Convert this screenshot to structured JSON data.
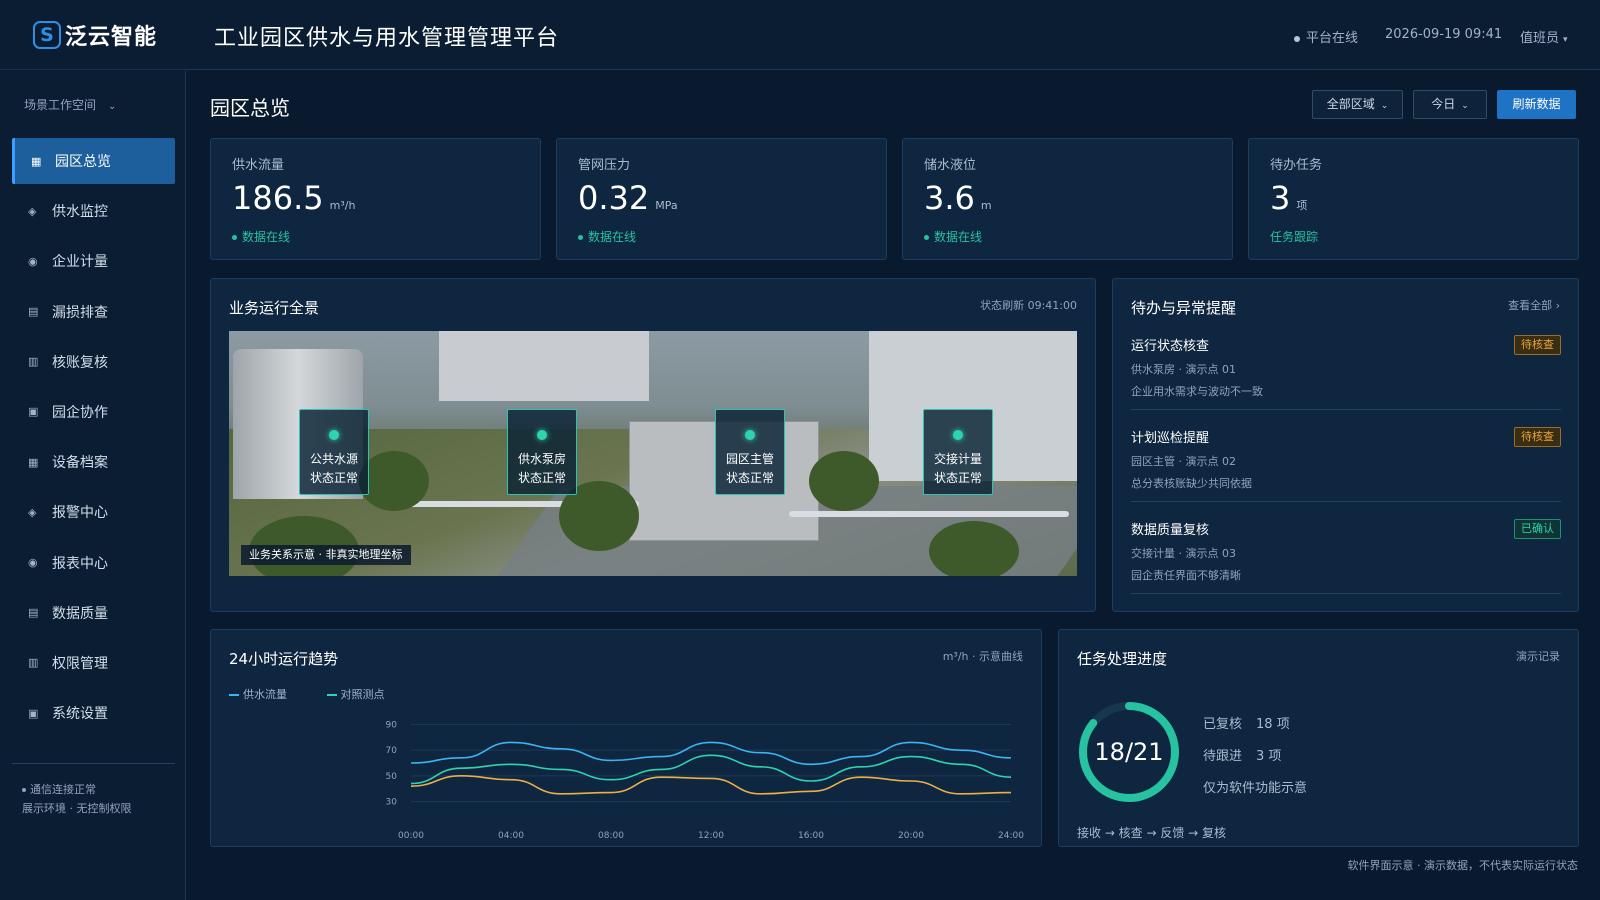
{
  "header": {
    "logo_mark": "S",
    "logo_text": "泛云智能",
    "title": "工业园区供水与用水管理管理平台",
    "status": "平台在线",
    "datetime": "2026-09-19 09:41",
    "user": "值班员"
  },
  "sidebar": {
    "workspace": "场景工作空间",
    "items": [
      {
        "label": "园区总览",
        "icon": "grid-icon",
        "glyph": "▦",
        "active": true
      },
      {
        "label": "供水监控",
        "icon": "diamond-icon",
        "glyph": "◈"
      },
      {
        "label": "企业计量",
        "icon": "target-icon",
        "glyph": "◉"
      },
      {
        "label": "漏损排查",
        "icon": "list-icon",
        "glyph": "▤"
      },
      {
        "label": "核账复核",
        "icon": "grid-icon",
        "glyph": "▥"
      },
      {
        "label": "园企协作",
        "icon": "square-icon",
        "glyph": "▣"
      },
      {
        "label": "设备档案",
        "icon": "grid-icon",
        "glyph": "▦"
      },
      {
        "label": "报警中心",
        "icon": "diamond-icon",
        "glyph": "◈"
      },
      {
        "label": "报表中心",
        "icon": "target-icon",
        "glyph": "◉"
      },
      {
        "label": "数据质量",
        "icon": "list-icon",
        "glyph": "▤"
      },
      {
        "label": "权限管理",
        "icon": "grid-icon",
        "glyph": "▥"
      },
      {
        "label": "系统设置",
        "icon": "square-icon",
        "glyph": "▣"
      }
    ],
    "footer_status": "通信连接正常",
    "footer_env": "展示环境 · 无控制权限"
  },
  "main": {
    "page_title": "园区总览",
    "filter_area": "全部区域",
    "filter_date": "今日",
    "refresh_label": "刷新数据"
  },
  "kpis": [
    {
      "label": "供水流量",
      "value": "186.5",
      "unit": "m³/h",
      "foot": "数据在线"
    },
    {
      "label": "管网压力",
      "value": "0.32",
      "unit": "MPa",
      "foot": "数据在线"
    },
    {
      "label": "储水液位",
      "value": "3.6",
      "unit": "m",
      "foot": "数据在线"
    },
    {
      "label": "待办任务",
      "value": "3",
      "unit": "项",
      "foot": "任务跟踪"
    }
  ],
  "overview": {
    "title": "业务运行全景",
    "meta": "状态刷新 09:41:00",
    "markers": [
      {
        "line1": "公共水源",
        "line2": "状态正常"
      },
      {
        "line1": "供水泵房",
        "line2": "状态正常"
      },
      {
        "line1": "园区主管",
        "line2": "状态正常"
      },
      {
        "line1": "交接计量",
        "line2": "状态正常"
      }
    ],
    "caption": "业务关系示意 · 非真实地理坐标"
  },
  "alerts": {
    "title": "待办与异常提醒",
    "view_all": "查看全部 ›",
    "items": [
      {
        "title": "运行状态核查",
        "sub1": "供水泵房 · 演示点 01",
        "sub2": "企业用水需求与波动不一致",
        "tag": "待核查",
        "tag_type": "warn"
      },
      {
        "title": "计划巡检提醒",
        "sub1": "园区主管 · 演示点 02",
        "sub2": "总分表核账缺少共同依据",
        "tag": "待核查",
        "tag_type": "warn"
      },
      {
        "title": "数据质量复核",
        "sub1": "交接计量 · 演示点 03",
        "sub2": "园企责任界面不够清晰",
        "tag": "已确认",
        "tag_type": "ok"
      }
    ]
  },
  "trend": {
    "title": "24小时运行趋势",
    "meta": "m³/h · 示意曲线"
  },
  "progress": {
    "title": "任务处理进度",
    "meta": "演示记录",
    "ring_label": "18/21",
    "done": 18,
    "total": 21,
    "row1_label": "已复核",
    "row1_value": "18 项",
    "row2_label": "待跟进",
    "row2_value": "3 项",
    "row3": "仅为软件功能示意",
    "flow": "接收 → 核查 → 反馈 → 复核"
  },
  "footer_note": "软件界面示意 · 演示数据，不代表实际运行状态",
  "colors": {
    "accent": "#1f73c4",
    "ok": "#27c2a0",
    "warn": "#e8a43c",
    "series_blue": "#3ab4f2",
    "series_teal": "#2ed3b0",
    "series_orange": "#e8b04a"
  },
  "chart_data": {
    "type": "line",
    "x": [
      "00:00",
      "02:00",
      "04:00",
      "06:00",
      "08:00",
      "10:00",
      "12:00",
      "14:00",
      "16:00",
      "18:00",
      "20:00",
      "22:00",
      "24:00"
    ],
    "xticks": [
      "00:00",
      "04:00",
      "08:00",
      "12:00",
      "16:00",
      "20:00",
      "24:00"
    ],
    "yticks": [
      90,
      70,
      50,
      30
    ],
    "ylim": [
      25,
      95
    ],
    "series": [
      {
        "name": "供水流量",
        "color": "#3ab4f2",
        "values": [
          60,
          64,
          76,
          71,
          62,
          65,
          76,
          68,
          59,
          65,
          76,
          70,
          64
        ]
      },
      {
        "name": "对照测点",
        "color": "#2ed3b0",
        "values": [
          44,
          56,
          59,
          55,
          47,
          55,
          66,
          57,
          46,
          57,
          65,
          59,
          49
        ]
      },
      {
        "name": "",
        "color": "#e8b04a",
        "values": [
          42,
          50,
          47,
          36,
          37,
          49,
          48,
          36,
          38,
          49,
          46,
          36,
          37
        ]
      }
    ],
    "legend_position": "top-left",
    "grid": true
  }
}
